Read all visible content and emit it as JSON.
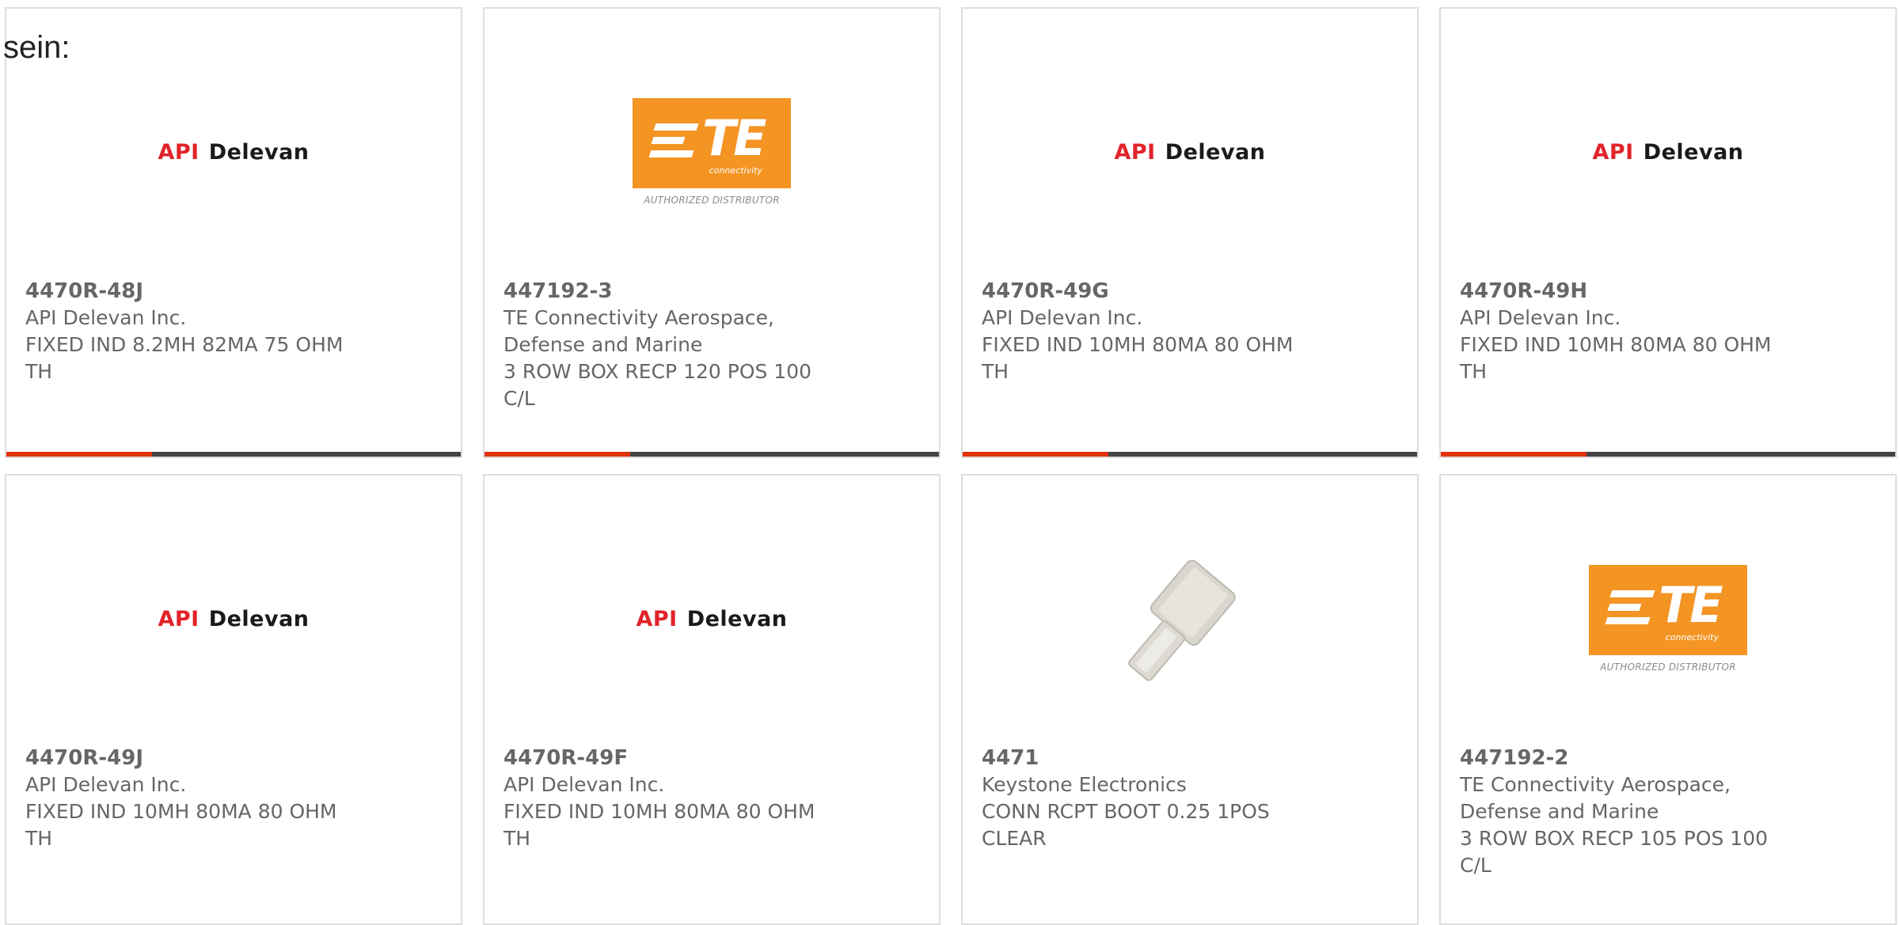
{
  "intro_text": "sein:",
  "cards": [
    {
      "part_number": "4470R-48J",
      "manufacturer": "API Delevan Inc.",
      "description_line1": "FIXED IND 8.2MH 82MA 75 OHM",
      "description_line2": "TH",
      "logo": {
        "type": "api-delevan",
        "api": "API",
        "name": "Delevan"
      }
    },
    {
      "part_number": "447192-3",
      "manufacturer": "TE Connectivity Aerospace, Defense and Marine",
      "description_line1": "3 ROW BOX RECP 120 POS 100",
      "description_line2": "C/L",
      "logo": {
        "type": "te-connectivity",
        "brand": "TE",
        "sub": "connectivity",
        "caption": "AUTHORIZED DISTRIBUTOR"
      }
    },
    {
      "part_number": "4470R-49G",
      "manufacturer": "API Delevan Inc.",
      "description_line1": "FIXED IND 10MH 80MA 80 OHM",
      "description_line2": "TH",
      "logo": {
        "type": "api-delevan",
        "api": "API",
        "name": "Delevan"
      }
    },
    {
      "part_number": "4470R-49H",
      "manufacturer": "API Delevan Inc.",
      "description_line1": "FIXED IND 10MH 80MA 80 OHM",
      "description_line2": "TH",
      "logo": {
        "type": "api-delevan",
        "api": "API",
        "name": "Delevan"
      }
    },
    {
      "part_number": "4470R-49J",
      "manufacturer": "API Delevan Inc.",
      "description_line1": "FIXED IND 10MH 80MA 80 OHM",
      "description_line2": "TH",
      "logo": {
        "type": "api-delevan",
        "api": "API",
        "name": "Delevan"
      }
    },
    {
      "part_number": "4470R-49F",
      "manufacturer": "API Delevan Inc.",
      "description_line1": "FIXED IND 10MH 80MA 80 OHM",
      "description_line2": "TH",
      "logo": {
        "type": "api-delevan",
        "api": "API",
        "name": "Delevan"
      }
    },
    {
      "part_number": "4471",
      "manufacturer": "Keystone Electronics",
      "description_line1": "CONN RCPT BOOT 0.25 1POS",
      "description_line2": "CLEAR",
      "logo": {
        "type": "product-photo"
      }
    },
    {
      "part_number": "447192-2",
      "manufacturer": "TE Connectivity Aerospace, Defense and Marine",
      "description_line1": "3 ROW BOX RECP 105 POS 100",
      "description_line2": "C/L",
      "logo": {
        "type": "te-connectivity",
        "brand": "TE",
        "sub": "connectivity",
        "caption": "AUTHORIZED DISTRIBUTOR"
      }
    }
  ],
  "colors": {
    "accent_bar": "#e2320b",
    "bar_dark": "#444444",
    "api_red": "#e2232a",
    "te_orange": "#f39423",
    "text_gray": "#666666"
  }
}
